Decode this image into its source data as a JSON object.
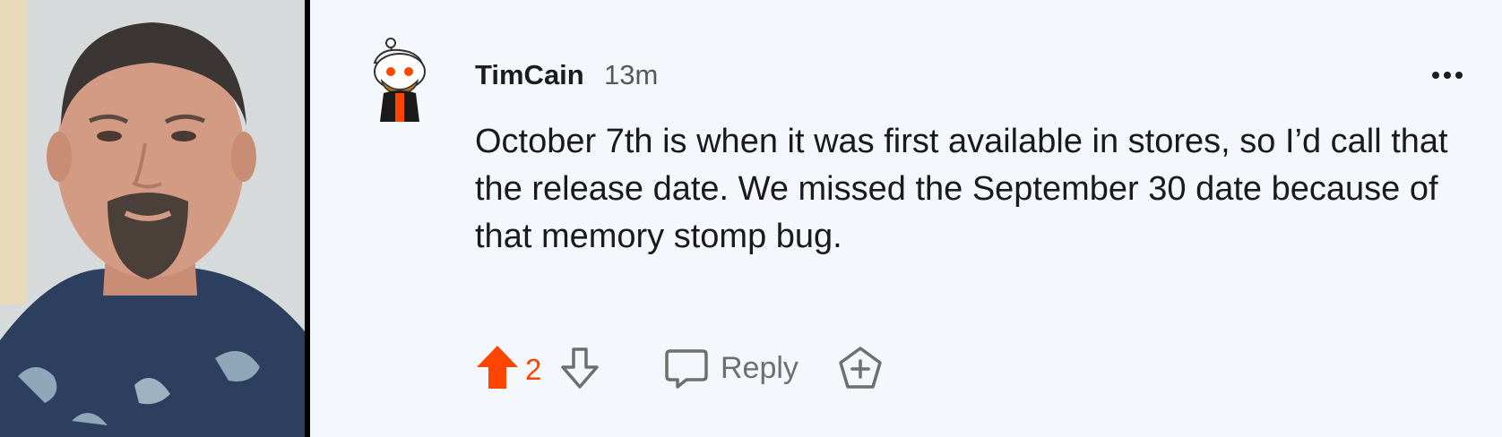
{
  "comment": {
    "username": "TimCain",
    "timestamp": "13m",
    "body": "October 7th is when it was first available in stores, so I’d call that the release date. We missed the September 30 date because of that memory stomp bug.",
    "score": "2",
    "reply_label": "Reply"
  },
  "icons": {
    "avatar": "reddit-snoo-avatar",
    "more": "more-options-icon",
    "upvote": "upvote-arrow-icon",
    "downvote": "downvote-arrow-icon",
    "reply": "reply-bubble-icon",
    "award": "award-plus-icon"
  },
  "colors": {
    "accent": "#ff4500",
    "background": "#f4f7fb",
    "text": "#1a1a1b",
    "muted": "#6f6f6f"
  }
}
